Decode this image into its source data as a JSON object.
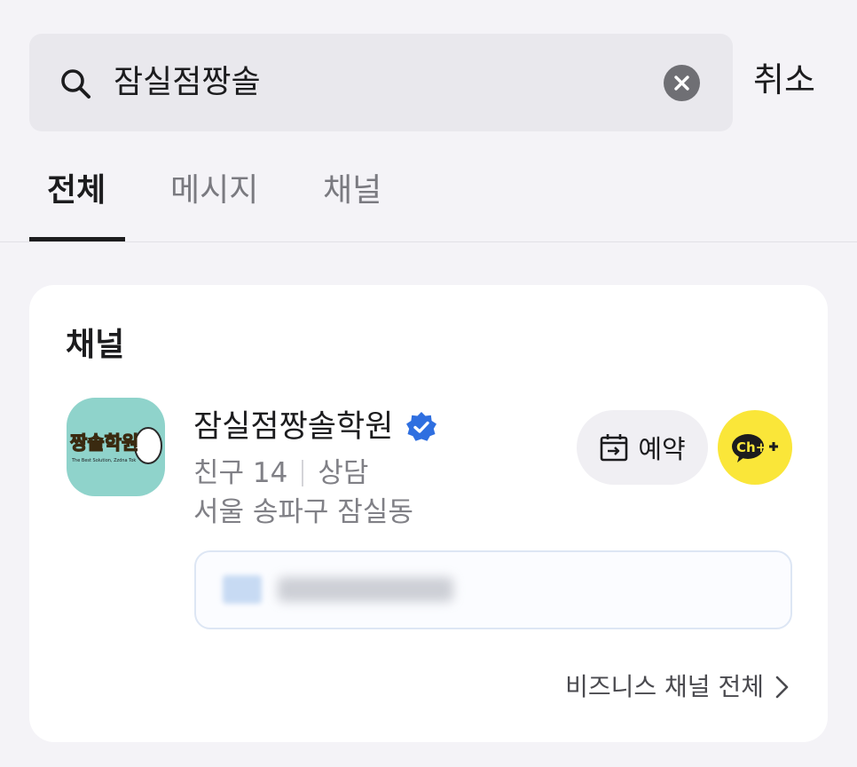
{
  "search": {
    "query": "잠실점짱솔",
    "cancel_label": "취소"
  },
  "tabs": [
    {
      "label": "전체",
      "active": true
    },
    {
      "label": "메시지",
      "active": false
    },
    {
      "label": "채널",
      "active": false
    }
  ],
  "section": {
    "title": "채널"
  },
  "channel": {
    "name": "잠실점짱솔학원",
    "friends_label": "친구 14",
    "consult_label": "상담",
    "location": "서울 송파구 잠실동",
    "logo_text": "짱솔학원",
    "logo_tagline": "The Best Solution, Zzdna Tok"
  },
  "actions": {
    "reserve_label": "예약",
    "add_channel_label": "Ch+"
  },
  "footer_link": {
    "label": "비즈니스 채널 전체"
  },
  "colors": {
    "accent_yellow": "#fae639",
    "verified_blue": "#2f6fe0",
    "logo_bg": "#8fd3cb"
  }
}
